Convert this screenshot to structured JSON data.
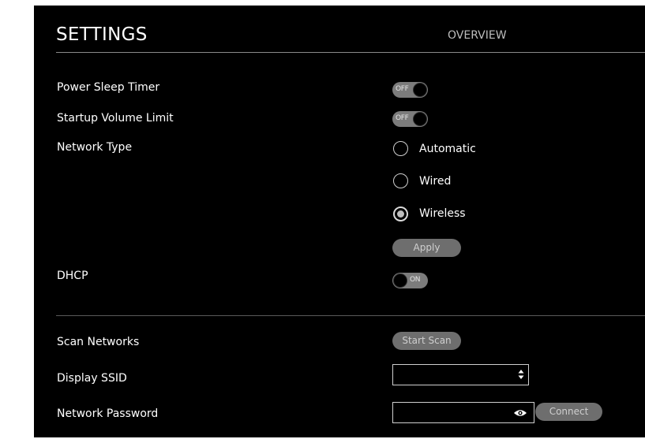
{
  "header": {
    "title": "SETTINGS",
    "tab_overview": "OVERVIEW"
  },
  "settings": {
    "power_sleep_timer": {
      "label": "Power Sleep Timer",
      "state": "OFF"
    },
    "startup_volume_limit": {
      "label": "Startup Volume Limit",
      "state": "OFF"
    },
    "network_type": {
      "label": "Network Type",
      "options": [
        "Automatic",
        "Wired",
        "Wireless"
      ],
      "selected": "Wireless"
    },
    "apply_label": "Apply",
    "dhcp": {
      "label": "DHCP",
      "state": "ON"
    },
    "scan_networks": {
      "label": "Scan Networks",
      "button": "Start Scan"
    },
    "display_ssid": {
      "label": "Display SSID",
      "value": "",
      "icon": "sort-arrows-icon"
    },
    "network_password": {
      "label": "Network Password",
      "value": "",
      "icon": "eye-icon",
      "connect_label": "Connect"
    }
  },
  "colors": {
    "background": "#000000",
    "toggle": "#7c7c7c",
    "button": "#6e6e6e",
    "text": "#ffffff"
  }
}
